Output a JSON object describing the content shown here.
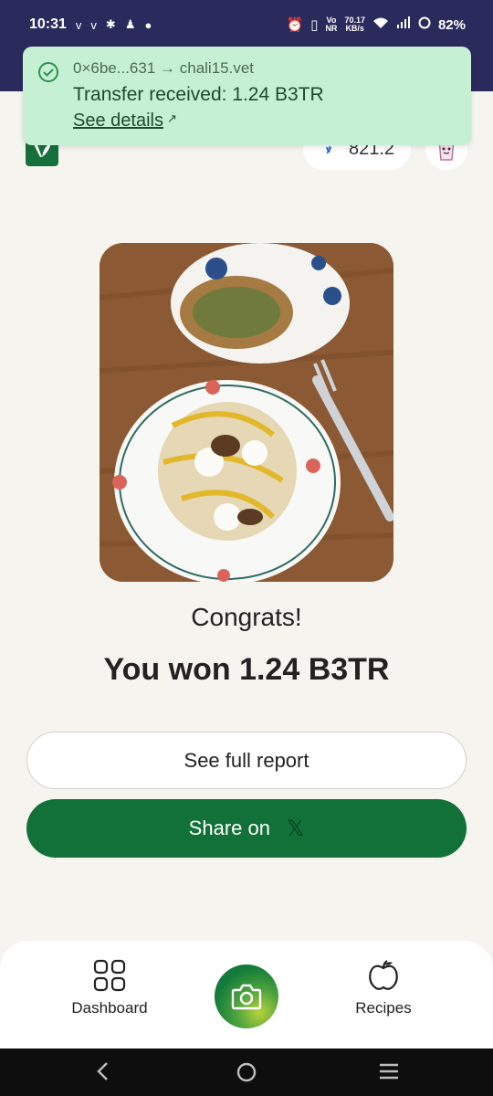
{
  "status_bar": {
    "time": "10:31",
    "left_icons": [
      "v-icon",
      "v-icon",
      "app-icon",
      "app-icon",
      "dot-icon"
    ],
    "network_speed_value": "70.17",
    "network_speed_unit": "KB/s",
    "volte_top": "Vo",
    "volte_bottom": "NR",
    "battery": "82%"
  },
  "notification": {
    "route_from": "0×6be...631",
    "route_arrow": "→",
    "route_to": "chali15.vet",
    "title": "Transfer received: 1.24 B3TR",
    "link_label": "See details",
    "link_arrow": "↗"
  },
  "header": {
    "balance": "821.2",
    "coin_symbol": "ꝟ"
  },
  "result": {
    "congrats": "Congrats!",
    "won": "You won 1.24 B3TR"
  },
  "actions": {
    "report_label": "See full report",
    "share_label": "Share on",
    "share_icon_text": "𝕏"
  },
  "bottom_nav": {
    "dashboard_label": "Dashboard",
    "recipes_label": "Recipes"
  },
  "colors": {
    "brand_green": "#127039",
    "notification_bg": "#c6f0d4",
    "status_bar_bg": "#2b2a5c",
    "page_bg": "#f6f4ef"
  }
}
